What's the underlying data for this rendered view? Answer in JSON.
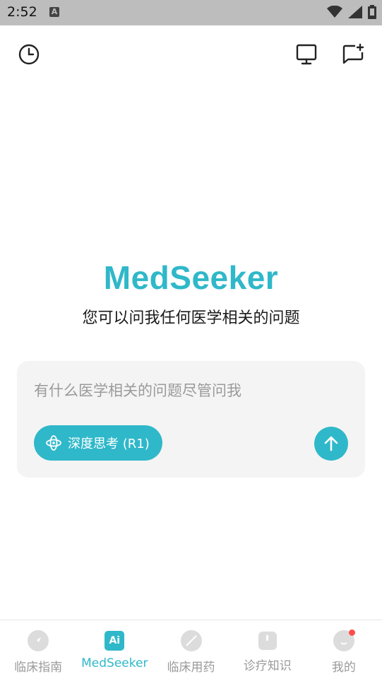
{
  "status_bar": {
    "time": "2:52",
    "notification_letter": "A"
  },
  "header": {
    "history_icon": "history-icon",
    "monitor_icon": "monitor-icon",
    "new_chat_icon": "new-chat-icon"
  },
  "brand": {
    "name": "MedSeeker",
    "subtitle": "您可以问我任何医学相关的问题",
    "color": "#2fb8c9"
  },
  "composer": {
    "placeholder": "有什么医学相关的问题尽管问我",
    "deep_think_label": "深度思考 (R1)",
    "send_icon": "arrow-up-icon"
  },
  "tabs": [
    {
      "label": "临床指南",
      "active": false
    },
    {
      "label": "MedSeeker",
      "active": true,
      "icon_text": "Ai"
    },
    {
      "label": "临床用药",
      "active": false
    },
    {
      "label": "诊疗知识",
      "active": false
    },
    {
      "label": "我的",
      "active": false
    }
  ]
}
